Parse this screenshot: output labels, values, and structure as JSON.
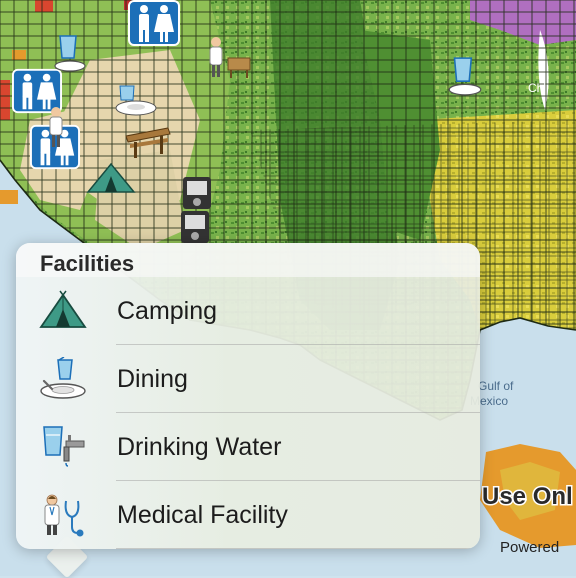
{
  "map": {
    "ocean_label_1": "Gulf of",
    "ocean_label_2": "Mexico",
    "city_label": "Chi",
    "overlay_text": "Use Onl",
    "attribution": "Powered",
    "icons": [
      "restroom-icon",
      "drinking-water-icon",
      "medical-facility-icon",
      "restroom-icon",
      "dining-icon",
      "restroom-icon",
      "picnic-icon",
      "camping-icon",
      "medical-facility-icon",
      "dining-icon",
      "dump-station-icon",
      "dump-station-icon",
      "drinking-water-icon"
    ]
  },
  "popover": {
    "title": "Facilities",
    "items": [
      {
        "label": "Camping",
        "icon": "camping-icon"
      },
      {
        "label": "Dining",
        "icon": "dining-icon"
      },
      {
        "label": "Drinking Water",
        "icon": "drinking-water-icon"
      },
      {
        "label": "Medical Facility",
        "icon": "medical-facility-icon"
      }
    ]
  },
  "colors": {
    "ocean": "#cfe3ee",
    "green_dark": "#3f7d2a",
    "green_mid": "#76b04a",
    "yellow": "#e5d43a",
    "tan": "#e8d7b0",
    "purple": "#b06fc0",
    "orange": "#e59a2d",
    "icon_blue": "#1c6fb8",
    "tent_green": "#3e9a86"
  }
}
